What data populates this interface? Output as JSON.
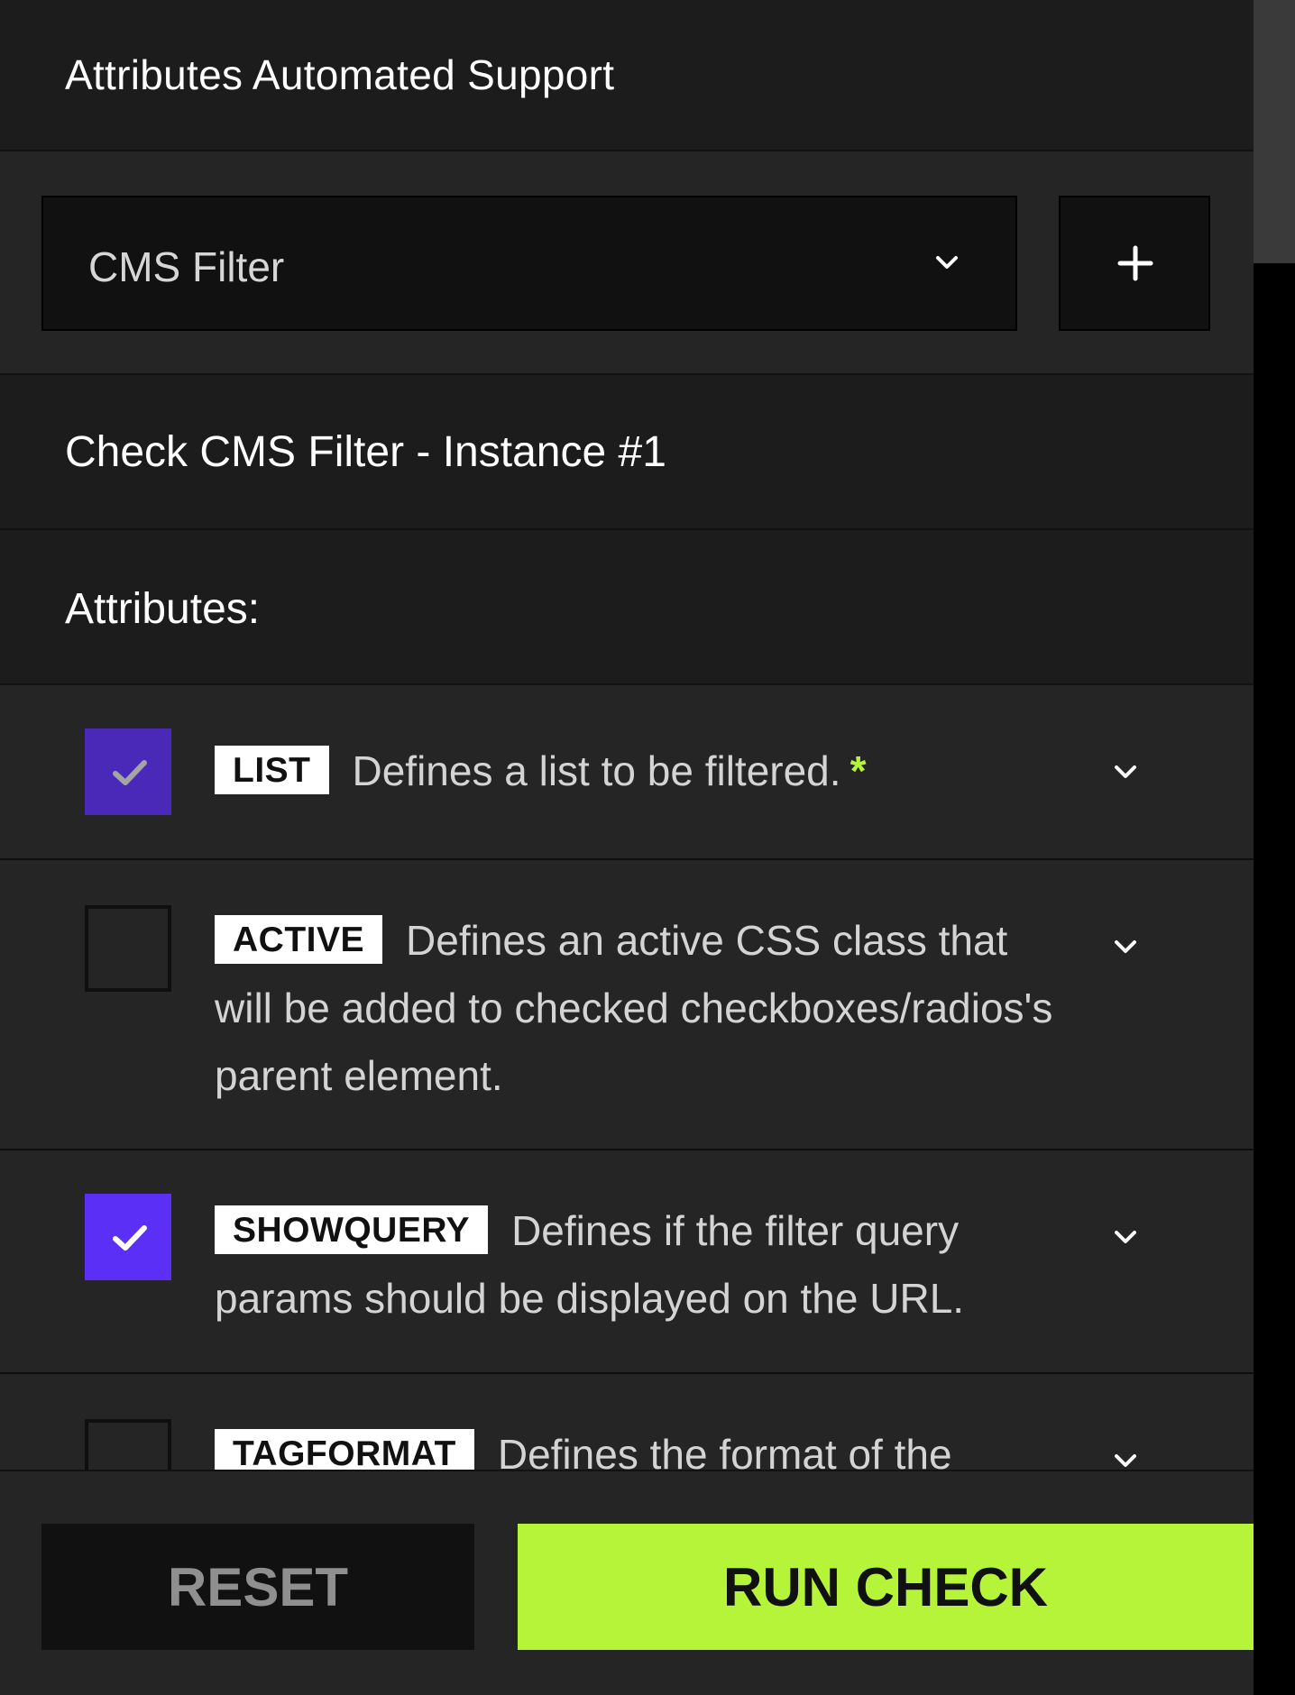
{
  "header": {
    "title": "Attributes Automated Support"
  },
  "selector": {
    "value": "CMS Filter",
    "add_label": "+"
  },
  "instance": {
    "label": "Check CMS Filter - Instance #1"
  },
  "attributes_heading": "Attributes:",
  "attributes": [
    {
      "tag": "LIST",
      "description": "Defines a list to be filtered.",
      "required_marker": "*",
      "checked": true,
      "disabled": true
    },
    {
      "tag": "ACTIVE",
      "description": "Defines an active CSS class that will be added to checked checkboxes/radios's parent element.",
      "checked": false
    },
    {
      "tag": "SHOWQUERY",
      "description": "Defines if the filter query params should be displayed on the URL.",
      "checked": true
    },
    {
      "tag": "TAGFORMAT",
      "description": "Defines the format of the",
      "checked": false
    }
  ],
  "footer": {
    "reset_label": "RESET",
    "run_label": "RUN CHECK"
  },
  "colors": {
    "accent": "#b6f43a",
    "checkbox": "#5b2ff5",
    "background": "#252525"
  }
}
